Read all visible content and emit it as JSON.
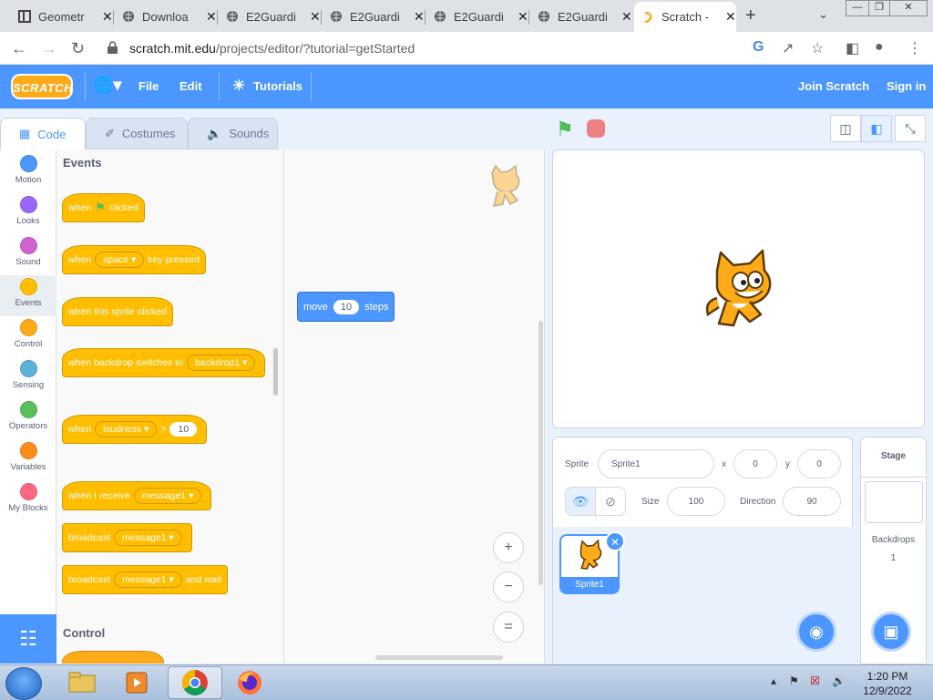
{
  "browser": {
    "tabs": [
      {
        "title": "Geometr",
        "icon": "geometry-favicon"
      },
      {
        "title": "Downloa",
        "icon": "globe-favicon"
      },
      {
        "title": "E2Guardi",
        "icon": "globe-favicon"
      },
      {
        "title": "E2Guardi",
        "icon": "globe-favicon"
      },
      {
        "title": "E2Guardi",
        "icon": "globe-favicon"
      },
      {
        "title": "E2Guardi",
        "icon": "globe-favicon"
      },
      {
        "title": "Scratch -",
        "icon": "scratch-favicon",
        "active": true
      }
    ],
    "close_glyph": "✕",
    "new_tab_glyph": "+",
    "url_host": "scratch.mit.edu",
    "url_path": "/projects/editor/?tutorial=getStarted"
  },
  "scratch_menu": {
    "logo": "SCRATCH",
    "file": "File",
    "edit": "Edit",
    "tutorials": "Tutorials",
    "join": "Join Scratch",
    "signin": "Sign in"
  },
  "editor_tabs": {
    "code": "Code",
    "costumes": "Costumes",
    "sounds": "Sounds"
  },
  "categories": [
    {
      "label": "Motion",
      "color": "#4c97ff"
    },
    {
      "label": "Looks",
      "color": "#9966ff"
    },
    {
      "label": "Sound",
      "color": "#cf63cf"
    },
    {
      "label": "Events",
      "color": "#ffbf00"
    },
    {
      "label": "Control",
      "color": "#ffab19"
    },
    {
      "label": "Sensing",
      "color": "#5cb1d6"
    },
    {
      "label": "Operators",
      "color": "#59c059"
    },
    {
      "label": "Variables",
      "color": "#ff8c1a"
    },
    {
      "label": "My Blocks",
      "color": "#ff6680"
    }
  ],
  "palette": {
    "events_title": "Events",
    "control_title": "Control",
    "b1_when": "when",
    "b1_clicked": "clicked",
    "b2_when": "when",
    "b2_key": "space",
    "b2_rest": "key pressed",
    "b3": "when this sprite clicked",
    "b4_text": "when backdrop switches to",
    "b4_dd": "backdrop1",
    "b5_when": "when",
    "b5_dd": "loudness",
    "b5_gt": ">",
    "b5_num": "10",
    "b6_text": "when I receive",
    "b6_dd": "message1",
    "b7_text": "broadcast",
    "b7_dd": "message1",
    "b8_text": "broadcast",
    "b8_dd": "message1",
    "b8_rest": "and wait"
  },
  "script_area": {
    "move_label": "move",
    "move_value": "10",
    "steps_label": "steps",
    "zoom_in": "+",
    "zoom_out": "−",
    "zoom_reset": "="
  },
  "sprite_info": {
    "sprite_label": "Sprite",
    "sprite_name": "Sprite1",
    "x_label": "x",
    "x_value": "0",
    "y_label": "y",
    "y_value": "0",
    "show_label": "Show",
    "size_label": "Size",
    "size_value": "100",
    "direction_label": "Direction",
    "direction_value": "90"
  },
  "sprite_list": {
    "sprite1": "Sprite1"
  },
  "stage_target": {
    "title": "Stage",
    "backdrops_label": "Backdrops",
    "backdrops_count": "1"
  },
  "taskbar": {
    "time": "1:20 PM",
    "date": "12/9/2022"
  },
  "colors": {
    "scratch_blue": "#4c97ff",
    "events_yellow": "#ffbf00",
    "go_green": "#4cbf56",
    "stop_red": "#ec5959"
  }
}
